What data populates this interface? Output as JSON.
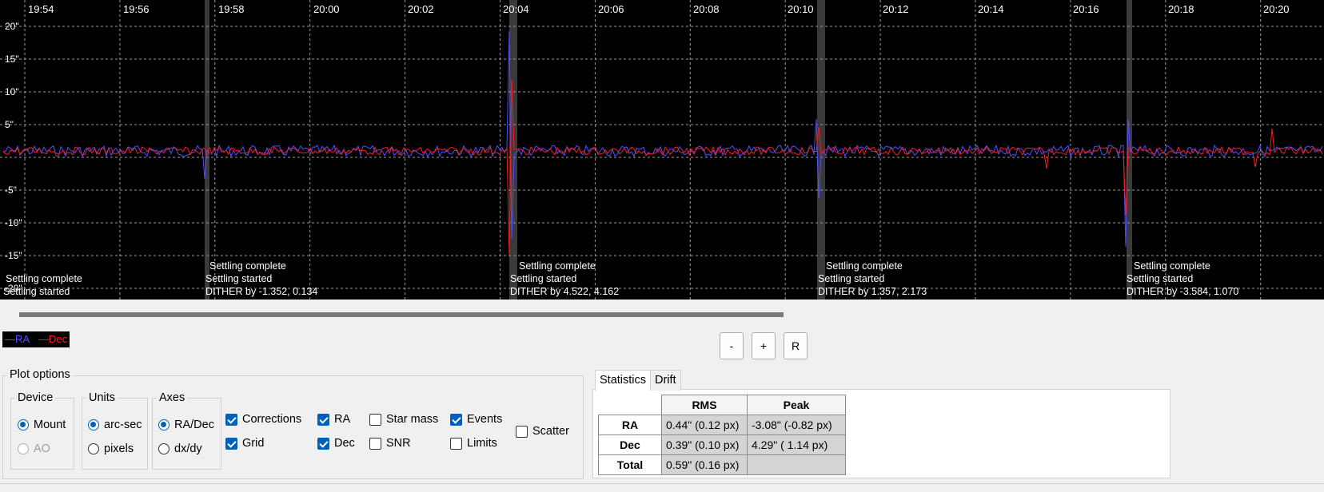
{
  "plot": {
    "time_labels": [
      "19:54",
      "19:56",
      "19:58",
      "20:00",
      "20:02",
      "20:04",
      "20:06",
      "20:08",
      "20:10",
      "20:12",
      "20:14",
      "20:16",
      "20:18",
      "20:20"
    ],
    "y_labels": [
      "20\"",
      "15\"",
      "10\"",
      "5\"",
      "-5\"",
      "-10\"",
      "-15\"",
      "-20\""
    ],
    "events": [
      {
        "settling_complete": "Settling complete",
        "settling_started": "Settling started",
        "dither": ""
      },
      {
        "settling_complete": "Settling complete",
        "settling_started": "Settling started",
        "dither": "DITHER by -1.352, 0.134"
      },
      {
        "settling_complete": "Settling complete",
        "settling_started": "Settling started",
        "dither": "DITHER by 4.522, 4.162"
      },
      {
        "settling_complete": "Settling complete",
        "settling_started": "Settling started",
        "dither": "DITHER by 1.357, 2.173"
      },
      {
        "settling_complete": "Settling complete",
        "settling_started": "Settling started",
        "dither": "DITHER by -3.584, 1.070"
      }
    ],
    "colors": {
      "ra": "#5050ff",
      "dec": "#ff1a1a",
      "grid": "#9a9a9a",
      "settle_band": "#3a3a3a"
    }
  },
  "legend": {
    "ra": "—RA",
    "dec": "—Dec"
  },
  "zoom": {
    "minus": "-",
    "plus": "+",
    "reset": "R"
  },
  "plot_options": {
    "title": "Plot options",
    "device": {
      "title": "Device",
      "mount": "Mount",
      "ao": "AO"
    },
    "units": {
      "title": "Units",
      "arcsec": "arc-sec",
      "pixels": "pixels"
    },
    "axes": {
      "title": "Axes",
      "radec": "RA/Dec",
      "dxdy": "dx/dy"
    },
    "checks": {
      "corrections": "Corrections",
      "grid": "Grid",
      "ra": "RA",
      "dec": "Dec",
      "star_mass": "Star mass",
      "snr": "SNR",
      "events": "Events",
      "limits": "Limits",
      "scatter": "Scatter"
    }
  },
  "tabs": {
    "statistics": "Statistics",
    "drift": "Drift"
  },
  "stats": {
    "headers": [
      "RMS",
      "Peak"
    ],
    "rows": [
      {
        "label": "RA",
        "rms": "0.44\" (0.12 px)",
        "peak": "-3.08\" (-0.82 px)"
      },
      {
        "label": "Dec",
        "rms": "0.39\" (0.10 px)",
        "peak": "4.29\" ( 1.14 px)"
      },
      {
        "label": "Total",
        "rms": "0.59\" (0.16 px)",
        "peak": ""
      }
    ]
  }
}
